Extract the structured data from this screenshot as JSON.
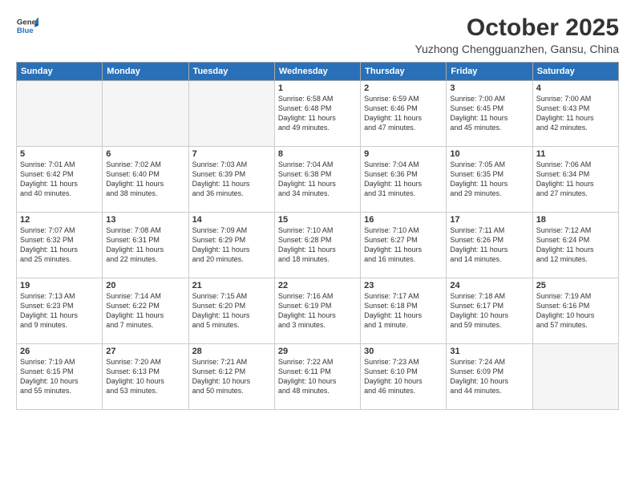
{
  "header": {
    "logo_line1": "General",
    "logo_line2": "Blue",
    "month": "October 2025",
    "location": "Yuzhong Chengguanzhen, Gansu, China"
  },
  "weekdays": [
    "Sunday",
    "Monday",
    "Tuesday",
    "Wednesday",
    "Thursday",
    "Friday",
    "Saturday"
  ],
  "weeks": [
    [
      {
        "day": "",
        "text": ""
      },
      {
        "day": "",
        "text": ""
      },
      {
        "day": "",
        "text": ""
      },
      {
        "day": "1",
        "text": "Sunrise: 6:58 AM\nSunset: 6:48 PM\nDaylight: 11 hours\nand 49 minutes."
      },
      {
        "day": "2",
        "text": "Sunrise: 6:59 AM\nSunset: 6:46 PM\nDaylight: 11 hours\nand 47 minutes."
      },
      {
        "day": "3",
        "text": "Sunrise: 7:00 AM\nSunset: 6:45 PM\nDaylight: 11 hours\nand 45 minutes."
      },
      {
        "day": "4",
        "text": "Sunrise: 7:00 AM\nSunset: 6:43 PM\nDaylight: 11 hours\nand 42 minutes."
      }
    ],
    [
      {
        "day": "5",
        "text": "Sunrise: 7:01 AM\nSunset: 6:42 PM\nDaylight: 11 hours\nand 40 minutes."
      },
      {
        "day": "6",
        "text": "Sunrise: 7:02 AM\nSunset: 6:40 PM\nDaylight: 11 hours\nand 38 minutes."
      },
      {
        "day": "7",
        "text": "Sunrise: 7:03 AM\nSunset: 6:39 PM\nDaylight: 11 hours\nand 36 minutes."
      },
      {
        "day": "8",
        "text": "Sunrise: 7:04 AM\nSunset: 6:38 PM\nDaylight: 11 hours\nand 34 minutes."
      },
      {
        "day": "9",
        "text": "Sunrise: 7:04 AM\nSunset: 6:36 PM\nDaylight: 11 hours\nand 31 minutes."
      },
      {
        "day": "10",
        "text": "Sunrise: 7:05 AM\nSunset: 6:35 PM\nDaylight: 11 hours\nand 29 minutes."
      },
      {
        "day": "11",
        "text": "Sunrise: 7:06 AM\nSunset: 6:34 PM\nDaylight: 11 hours\nand 27 minutes."
      }
    ],
    [
      {
        "day": "12",
        "text": "Sunrise: 7:07 AM\nSunset: 6:32 PM\nDaylight: 11 hours\nand 25 minutes."
      },
      {
        "day": "13",
        "text": "Sunrise: 7:08 AM\nSunset: 6:31 PM\nDaylight: 11 hours\nand 22 minutes."
      },
      {
        "day": "14",
        "text": "Sunrise: 7:09 AM\nSunset: 6:29 PM\nDaylight: 11 hours\nand 20 minutes."
      },
      {
        "day": "15",
        "text": "Sunrise: 7:10 AM\nSunset: 6:28 PM\nDaylight: 11 hours\nand 18 minutes."
      },
      {
        "day": "16",
        "text": "Sunrise: 7:10 AM\nSunset: 6:27 PM\nDaylight: 11 hours\nand 16 minutes."
      },
      {
        "day": "17",
        "text": "Sunrise: 7:11 AM\nSunset: 6:26 PM\nDaylight: 11 hours\nand 14 minutes."
      },
      {
        "day": "18",
        "text": "Sunrise: 7:12 AM\nSunset: 6:24 PM\nDaylight: 11 hours\nand 12 minutes."
      }
    ],
    [
      {
        "day": "19",
        "text": "Sunrise: 7:13 AM\nSunset: 6:23 PM\nDaylight: 11 hours\nand 9 minutes."
      },
      {
        "day": "20",
        "text": "Sunrise: 7:14 AM\nSunset: 6:22 PM\nDaylight: 11 hours\nand 7 minutes."
      },
      {
        "day": "21",
        "text": "Sunrise: 7:15 AM\nSunset: 6:20 PM\nDaylight: 11 hours\nand 5 minutes."
      },
      {
        "day": "22",
        "text": "Sunrise: 7:16 AM\nSunset: 6:19 PM\nDaylight: 11 hours\nand 3 minutes."
      },
      {
        "day": "23",
        "text": "Sunrise: 7:17 AM\nSunset: 6:18 PM\nDaylight: 11 hours\nand 1 minute."
      },
      {
        "day": "24",
        "text": "Sunrise: 7:18 AM\nSunset: 6:17 PM\nDaylight: 10 hours\nand 59 minutes."
      },
      {
        "day": "25",
        "text": "Sunrise: 7:19 AM\nSunset: 6:16 PM\nDaylight: 10 hours\nand 57 minutes."
      }
    ],
    [
      {
        "day": "26",
        "text": "Sunrise: 7:19 AM\nSunset: 6:15 PM\nDaylight: 10 hours\nand 55 minutes."
      },
      {
        "day": "27",
        "text": "Sunrise: 7:20 AM\nSunset: 6:13 PM\nDaylight: 10 hours\nand 53 minutes."
      },
      {
        "day": "28",
        "text": "Sunrise: 7:21 AM\nSunset: 6:12 PM\nDaylight: 10 hours\nand 50 minutes."
      },
      {
        "day": "29",
        "text": "Sunrise: 7:22 AM\nSunset: 6:11 PM\nDaylight: 10 hours\nand 48 minutes."
      },
      {
        "day": "30",
        "text": "Sunrise: 7:23 AM\nSunset: 6:10 PM\nDaylight: 10 hours\nand 46 minutes."
      },
      {
        "day": "31",
        "text": "Sunrise: 7:24 AM\nSunset: 6:09 PM\nDaylight: 10 hours\nand 44 minutes."
      },
      {
        "day": "",
        "text": ""
      }
    ]
  ]
}
